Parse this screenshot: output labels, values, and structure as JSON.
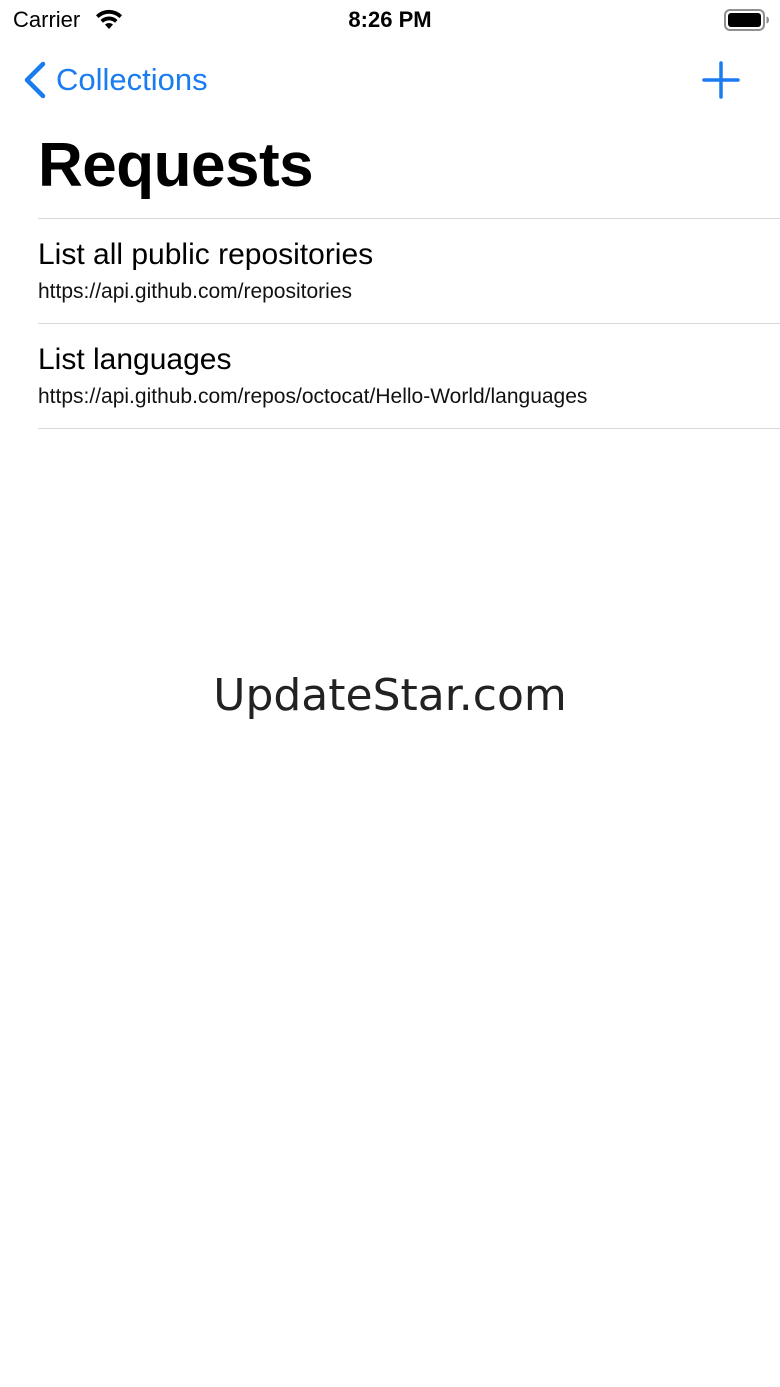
{
  "status_bar": {
    "carrier": "Carrier",
    "time": "8:26 PM",
    "wifi_icon": "wifi-icon",
    "battery_icon": "battery-full-icon"
  },
  "nav_bar": {
    "back_label": "Collections",
    "back_icon": "chevron-left-icon",
    "add_icon": "plus-icon",
    "accent_color": "#1a7cf0"
  },
  "page": {
    "title": "Requests"
  },
  "requests": [
    {
      "title": "List all public repositories",
      "url": "https://api.github.com/repositories"
    },
    {
      "title": "List languages",
      "url": "https://api.github.com/repos/octocat/Hello-World/languages"
    }
  ],
  "watermark": {
    "text": "UpdateStar.com"
  }
}
